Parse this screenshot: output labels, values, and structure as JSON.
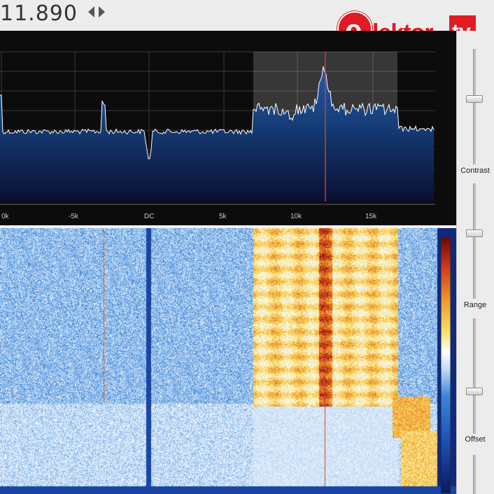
{
  "frequency_display": {
    "value": "11.890",
    "step_left_icon": "left-triangle-icon",
    "step_right_icon": "right-triangle-icon"
  },
  "logo": {
    "text_e": "e",
    "text_lektor": "lektor",
    "text_tv": "tv",
    "icon": "elektor-logo"
  },
  "spectrum": {
    "x_ticks": [
      "0k",
      "-5k",
      "DC",
      "5k",
      "10k",
      "15k"
    ],
    "passband_color": "#ffffff",
    "tuning_marker_color": "#d63a2a",
    "trace_color": "#ffffff",
    "fill_gradient": [
      "#1f5fad",
      "#0a0f30"
    ]
  },
  "waterfall": {
    "colormap": [
      "#0a1960",
      "#1d4fb2",
      "#3d86d8",
      "#bcd8f5",
      "#ffffff",
      "#f9e06a",
      "#ef9b2c",
      "#d23b1a",
      "#6b0606"
    ]
  },
  "sliders": {
    "contrast": {
      "label": "Contrast",
      "level": 0.65
    },
    "range": {
      "label": "Range",
      "level": 0.65
    },
    "offset": {
      "label": "Offset",
      "level": 0.45
    }
  }
}
